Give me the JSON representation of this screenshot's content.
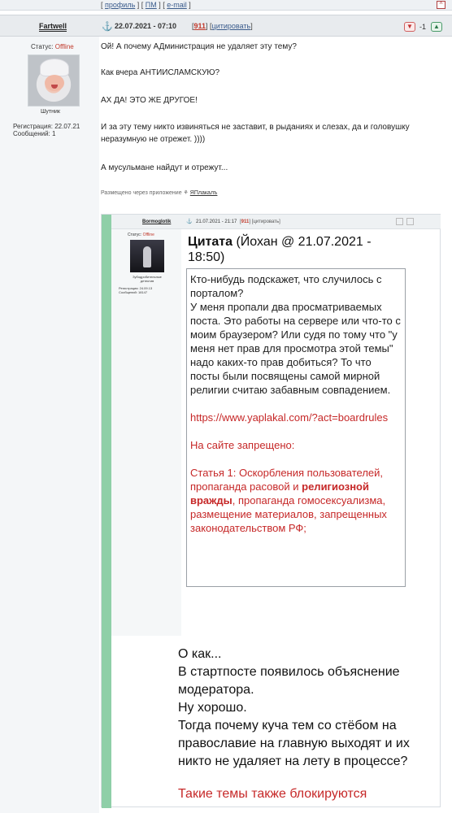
{
  "topbar": {
    "profile": "профиль",
    "pm": "ПМ",
    "email": "e-mail",
    "up_glyph": "^"
  },
  "post": {
    "author": "Fartwell",
    "date": "22.07.2021 - 07:10",
    "number": "911",
    "cite_label": "цитировать",
    "score": "-1",
    "status_label": "Статус:",
    "status_value": "Offline",
    "rank": "Шутник",
    "registration": "Регистрация: 22.07.21",
    "messages": "Сообщений: 1",
    "lines": [
      "Ой! А почему АДминистрация не удаляет эту тему?",
      "Как вчера АНТИИСЛАМСКУЮ?",
      "АХ ДА! ЭТО ЖЕ ДРУГОЕ!",
      "И за эту тему никто извиняться не заставит, в рыданиях и слезах, да и головушку неразумную не отрежет. ))))",
      "А мусульмане найдут и отрежут..."
    ],
    "via_text": "Размещено через приложение",
    "via_app": "ЯПлакалъ"
  },
  "quote_image": {
    "author": "Bormoglotik",
    "date": "21.07.2021 - 21:17",
    "number": "911",
    "cite_label": "цитировать",
    "status_label": "Статус:",
    "status_value": "Offline",
    "rank": "Зубодробительные детектив",
    "registration": "Регистрация: 24.09.13",
    "messages": "Сообщений: 18147",
    "quote_title_bold": "Цитата",
    "quote_title_rest": " (Йохан @ 21.07.2021 - 18:50)",
    "quote_para1": "Кто-нибудь подскажет, что случилось с порталом?",
    "quote_para2": "У меня пропали два просматриваемых поста. Это работы на сервере или что-то с моим браузером? Или судя по тому что \"у меня нет прав для просмотра этой темы\" надо каких-то прав добиться? То что посты были посвящены самой мирной религии считаю забавным совпадением.",
    "rules_link": "https://www.yaplakal.com/?act=boardrules",
    "forbidden": "На сайте запрещено:",
    "article_start": "Статья 1: Оскорбления пользователей, пропаганда расовой и ",
    "article_bold": "религиозной вражды",
    "article_end": ", пропаганда гомосексуализма, размещение материалов, запрещенных законодательством РФ;",
    "reply_lines": [
      "О как...",
      "В стартпосте появилось объяснение модератора.",
      "Ну хорошо.",
      "Тогда почему куча тем со стёбом на православие на главную выходят и их никто не удаляет на лету в процессе?"
    ],
    "reply_red": "Такие темы также блокируются"
  }
}
